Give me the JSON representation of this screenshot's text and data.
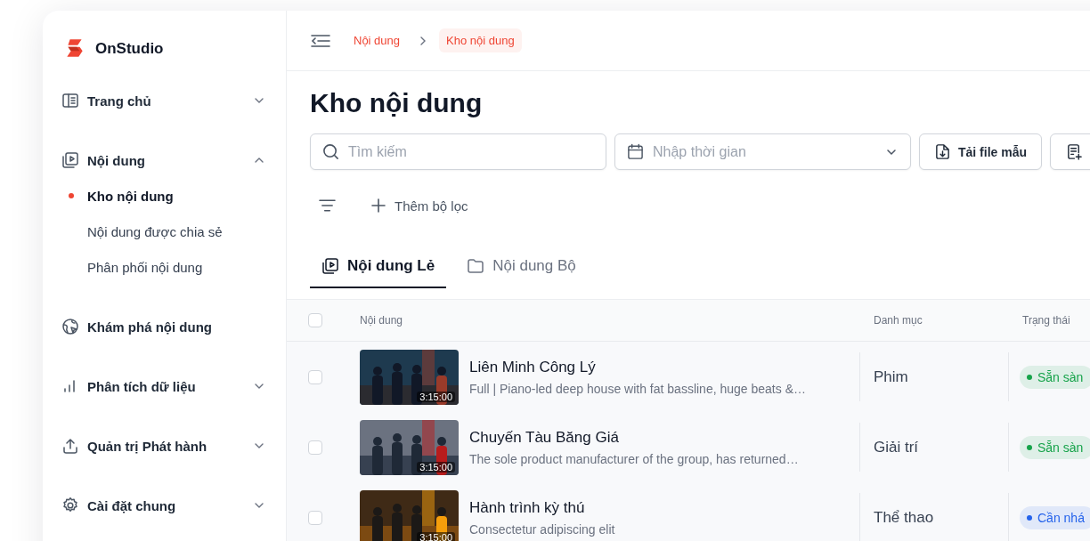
{
  "brand": {
    "name": "OnStudio"
  },
  "sidebar": {
    "items": [
      {
        "label": "Trang chủ",
        "expanded": false
      },
      {
        "label": "Nội dung",
        "expanded": true,
        "children": [
          {
            "label": "Kho nội dung",
            "selected": true
          },
          {
            "label": "Nội dung được chia sẻ",
            "selected": false
          },
          {
            "label": "Phân phối nội dung",
            "selected": false
          }
        ]
      },
      {
        "label": "Khám phá nội dung"
      },
      {
        "label": "Phân tích dữ liệu",
        "expanded": false
      },
      {
        "label": "Quản trị Phát hành",
        "expanded": false
      },
      {
        "label": "Cài đặt chung",
        "expanded": false
      }
    ]
  },
  "breadcrumb": [
    {
      "label": "Nội dung",
      "selected": false
    },
    {
      "label": "Kho nội dung",
      "selected": true
    }
  ],
  "page_title": "Kho nội dung",
  "search": {
    "placeholder": "Tìm kiếm"
  },
  "date_field": {
    "placeholder": "Nhập thời gian"
  },
  "toolbar_buttons": [
    {
      "label": "Tải file mẫu"
    }
  ],
  "filter": {
    "add_label": "Thêm bộ lọc"
  },
  "tabs": [
    {
      "label": "Nội dung Lẻ",
      "selected": true
    },
    {
      "label": "Nội dung Bộ",
      "selected": false
    }
  ],
  "table": {
    "all_checked": false,
    "columns": [
      "Nội dung",
      "Danh mục",
      "Trạng thái"
    ],
    "rows": [
      {
        "checked": false,
        "title": "Liên Minh Công Lý",
        "description": "Full | Piano-led deep house with fat bassline, huge beats &…",
        "duration": "3:15:00",
        "category": "Phim",
        "status": {
          "label": "Sẵn sàn",
          "color": "#16a34a"
        }
      },
      {
        "checked": false,
        "title": "Chuyến Tàu Băng Giá",
        "description": "The sole product manufacturer of the group, has returned…",
        "duration": "3:15:00",
        "category": "Giải trí",
        "status": {
          "label": "Sẵn sàn",
          "color": "#16a34a"
        }
      },
      {
        "checked": false,
        "title": "Hành trình kỳ thú",
        "description": "Consectetur adipiscing elit",
        "duration": "3:15:00",
        "category": "Thể thao",
        "status": {
          "label": "Cần nhá",
          "color": "#2563eb"
        }
      }
    ]
  }
}
